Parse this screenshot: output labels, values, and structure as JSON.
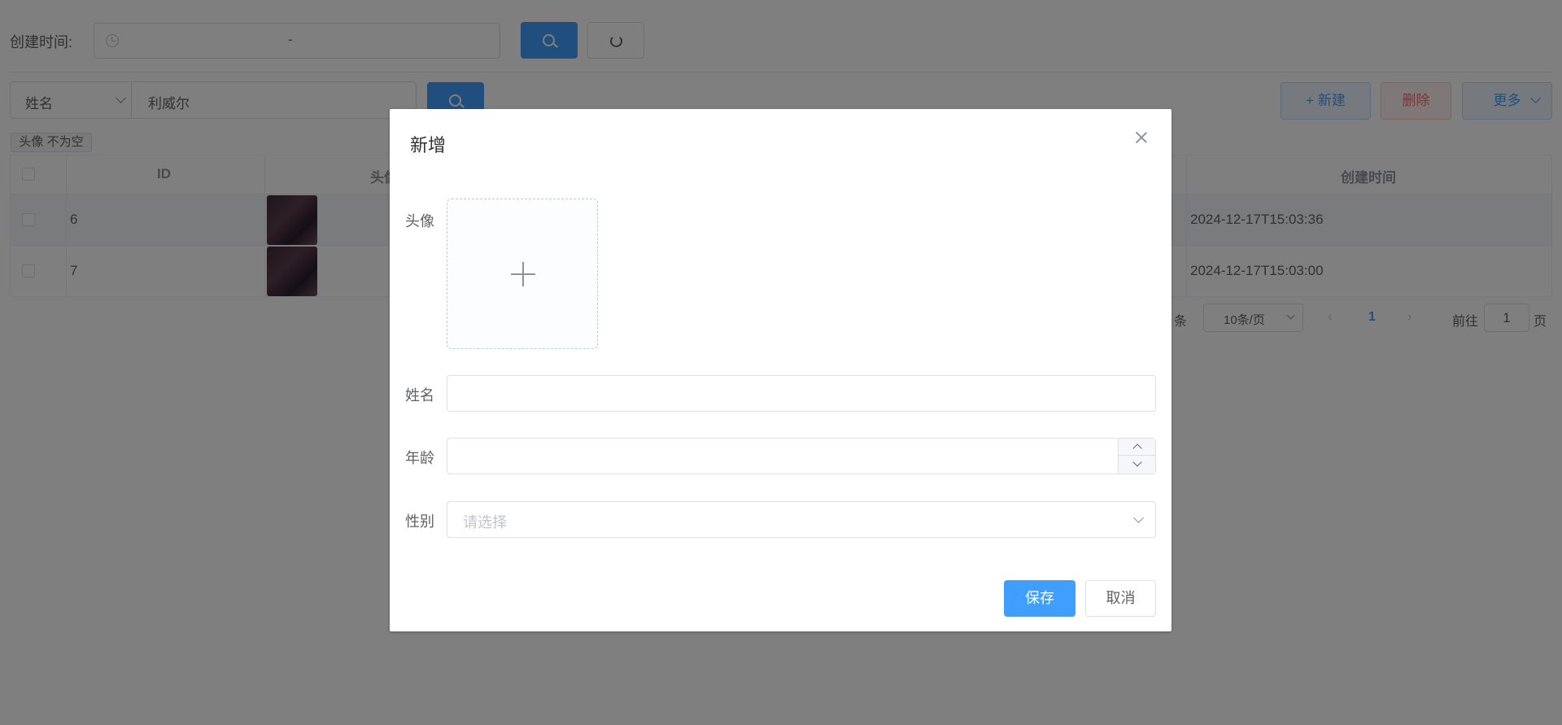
{
  "filters": {
    "created_time_label": "创建时间:",
    "date_range_separator": "-",
    "search_type": "姓名",
    "keyword": "利威尔",
    "active_tag": "头像 不为空"
  },
  "toolbar": {
    "new_label": "+ 新建",
    "delete_label": "删除",
    "more_label": "更多"
  },
  "table": {
    "headers": {
      "id": "ID",
      "avatar": "头像",
      "created": "创建时间"
    },
    "rows": [
      {
        "id": "6",
        "created": "2024-12-17T15:03:36"
      },
      {
        "id": "7",
        "created": "2024-12-17T15:03:00"
      }
    ]
  },
  "pager": {
    "total_suffix": "条",
    "page_size": "10条/页",
    "current_page": "1",
    "goto_label": "前往",
    "goto_value": "1",
    "page_suffix": "页"
  },
  "dialog": {
    "title": "新增",
    "fields": {
      "avatar": "头像",
      "name": "姓名",
      "age": "年龄",
      "gender": "性别"
    },
    "gender_placeholder": "请选择",
    "save_label": "保存",
    "cancel_label": "取消"
  },
  "colors": {
    "primary": "#409eff",
    "danger": "#f56c6c",
    "mask": "rgba(0,0,0,0.5)"
  }
}
